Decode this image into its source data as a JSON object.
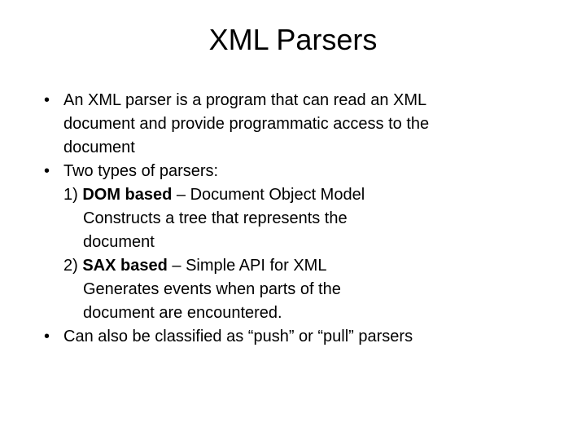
{
  "title": "XML Parsers",
  "bullets": [
    {
      "line1": "An XML parser is a program that can read an XML",
      "line2": "document and provide programmatic access to the",
      "line3": "document"
    },
    {
      "intro": "Two types of parsers:",
      "item1_num": "1) ",
      "item1_bold": "DOM based",
      "item1_rest": " – Document Object Model",
      "item1_sub1": "Constructs a tree that represents the",
      "item1_sub2": "document",
      "item2_num": "2) ",
      "item2_bold": "SAX based",
      "item2_rest": " – Simple API for XML",
      "item2_sub1": "Generates events when parts of the",
      "item2_sub2": "document are encountered."
    },
    {
      "line1": "Can also be classified as “push” or “pull” parsers"
    }
  ]
}
